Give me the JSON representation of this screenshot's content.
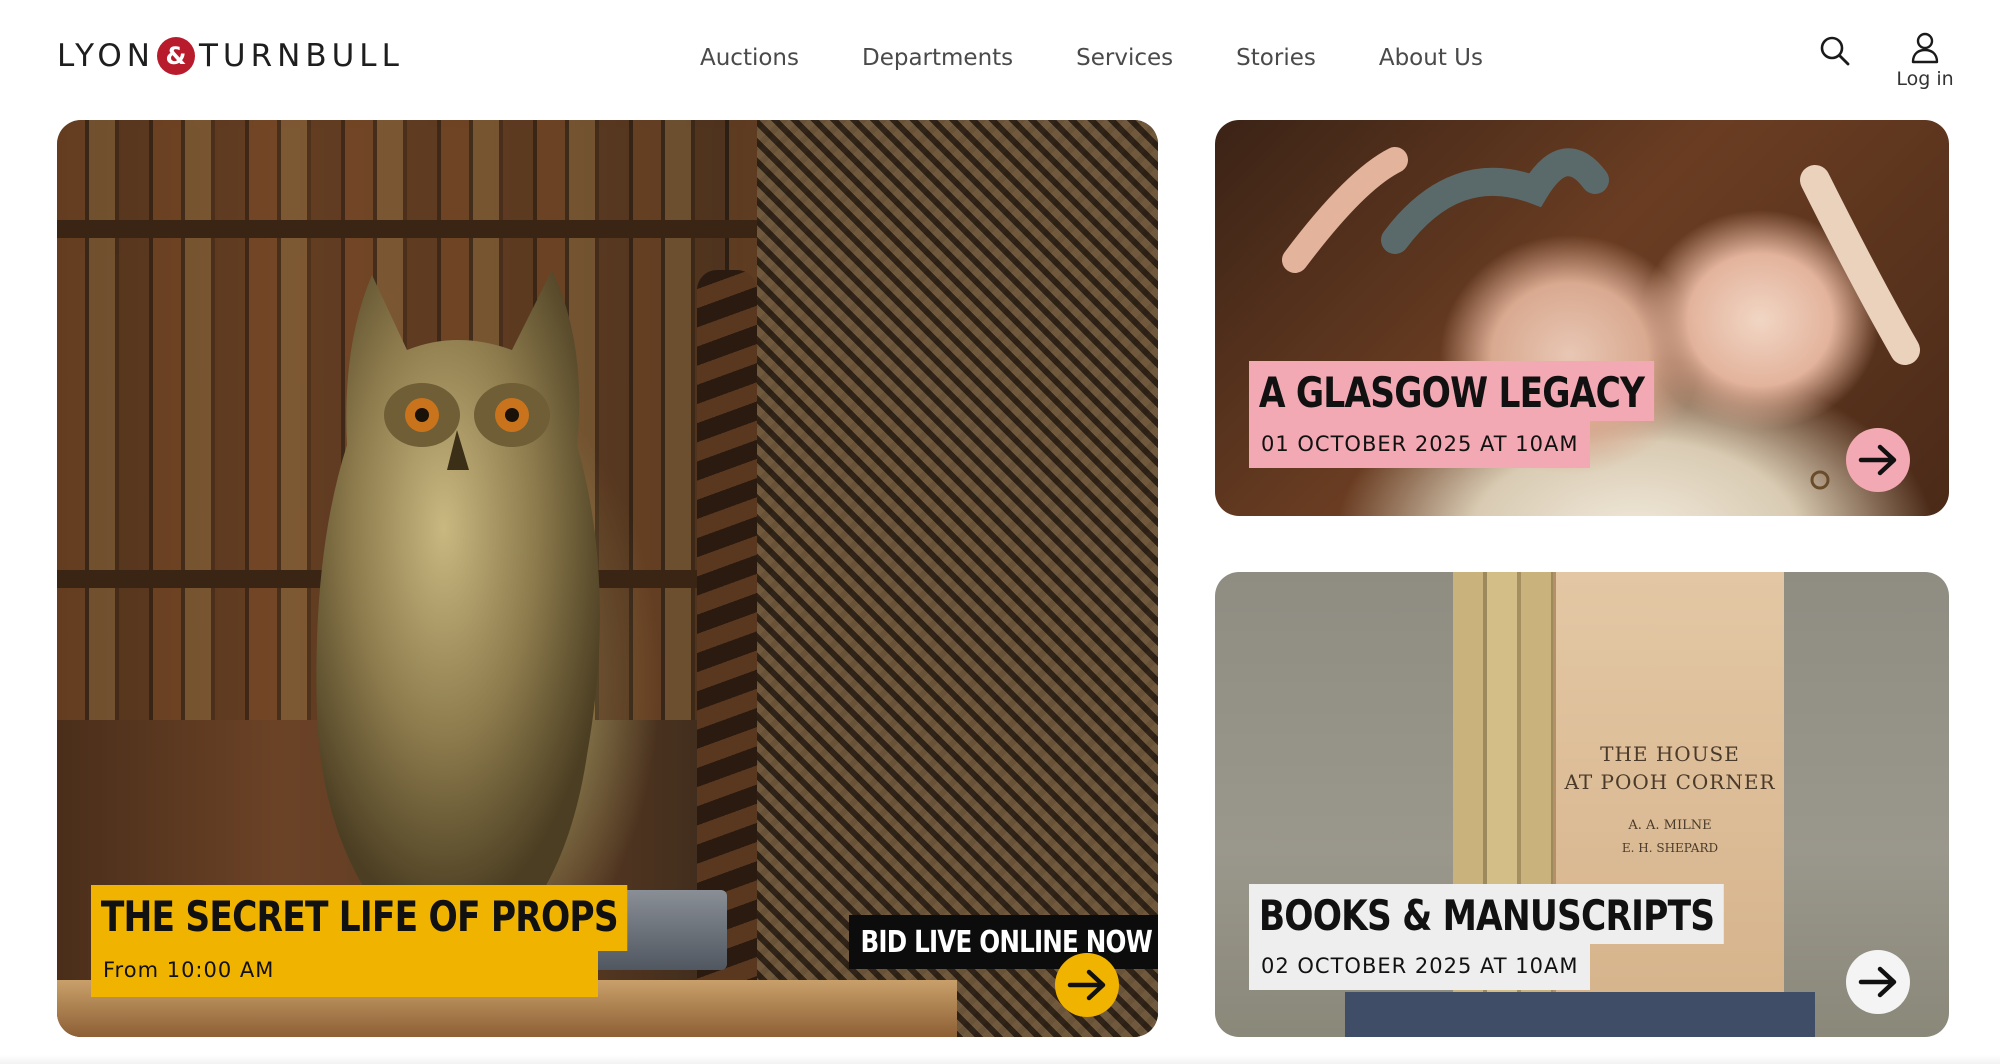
{
  "brand": {
    "left": "LYON",
    "amp": "&",
    "right": "TURNBULL",
    "accent_color": "#b81c2c"
  },
  "nav": {
    "items": [
      {
        "label": "Auctions"
      },
      {
        "label": "Departments"
      },
      {
        "label": "Services"
      },
      {
        "label": "Stories"
      },
      {
        "label": "About Us"
      }
    ]
  },
  "header_actions": {
    "search_icon": "search-icon",
    "user_icon": "user-icon",
    "login_label": "Log in"
  },
  "cards": {
    "main": {
      "title": "THE SECRET LIFE OF PROPS",
      "subtitle": "From 10:00 AM",
      "badge": "BID LIVE ONLINE NOW",
      "label_color": "#f0b400",
      "arrow_icon": "arrow-right-icon"
    },
    "glasgow": {
      "title": "A GLASGOW LEGACY",
      "date": "01 OCTOBER 2025 AT 10AM",
      "label_color": "#f2a9b3",
      "arrow_icon": "arrow-right-icon"
    },
    "books": {
      "title": "BOOKS & MANUSCRIPTS",
      "date": "02 OCTOBER 2025 AT 10AM",
      "label_color": "#efeeee",
      "arrow_icon": "arrow-right-icon",
      "book_cover": {
        "line1": "THE HOUSE",
        "line2": "AT POOH CORNER",
        "author": "A. A. MILNE",
        "decorations": "E. H. SHEPARD"
      }
    }
  }
}
